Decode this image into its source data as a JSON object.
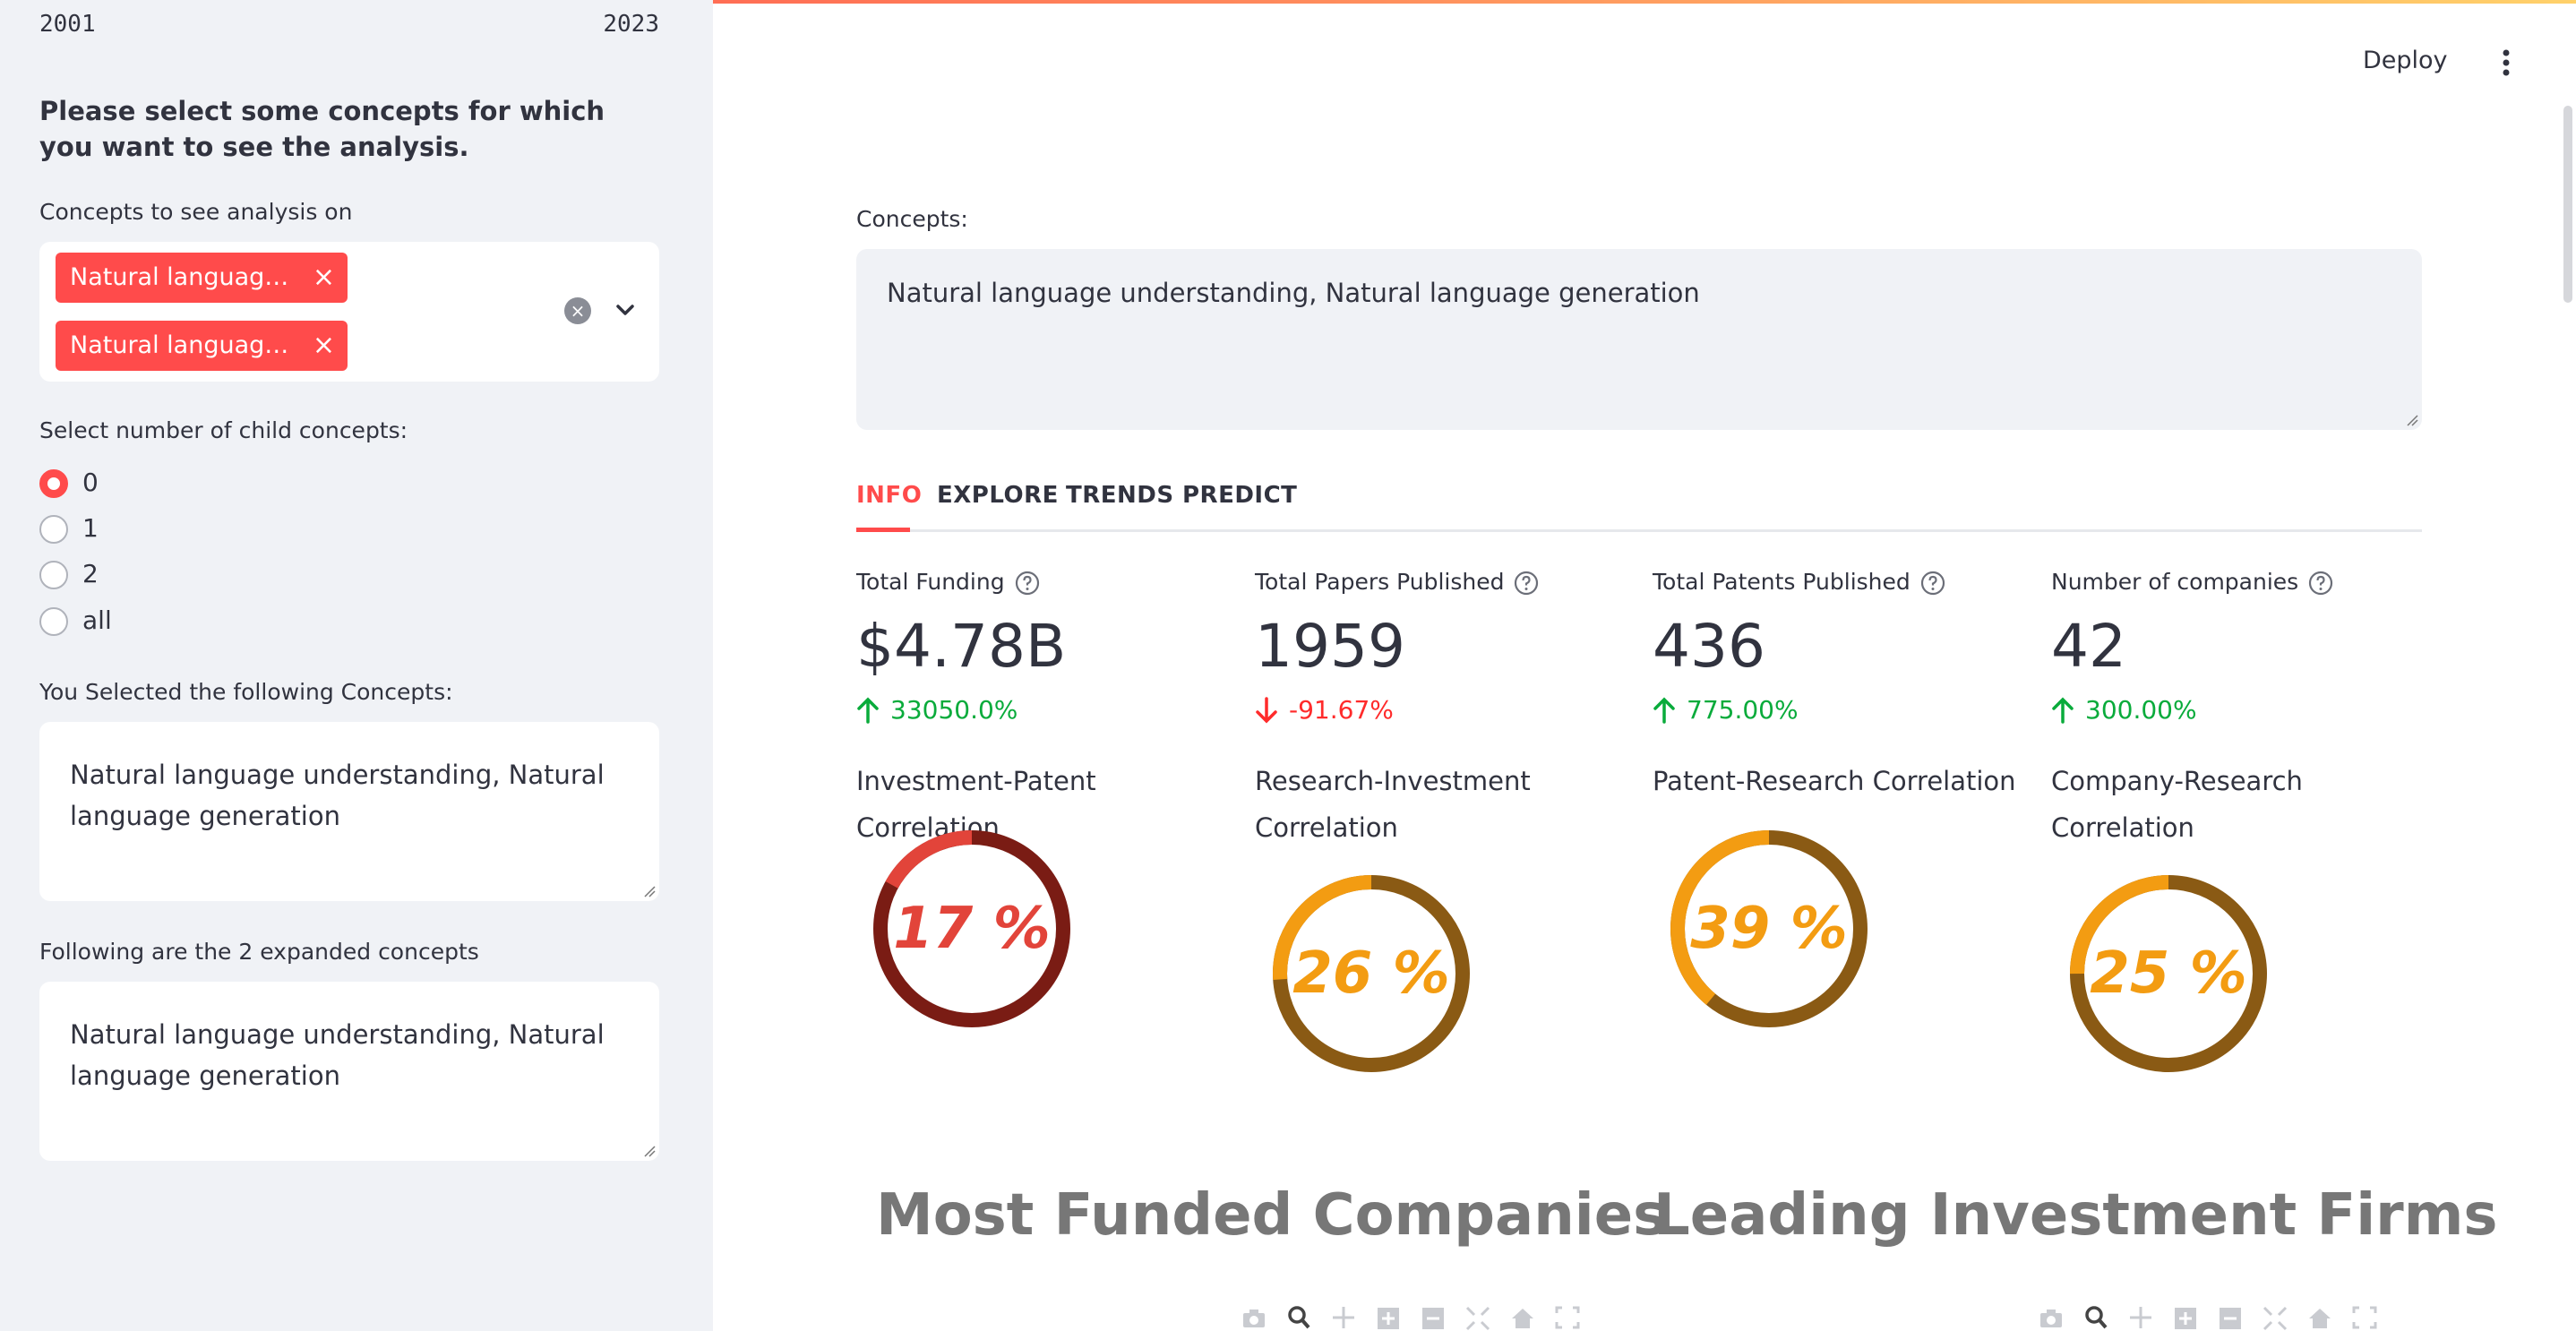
{
  "sidebar": {
    "slider_min": "2001",
    "slider_max": "2023",
    "heading": "Please select some concepts for which you want to see the analysis.",
    "concepts_label": "Concepts to see analysis on",
    "chips": [
      "Natural languag…",
      "Natural languag…"
    ],
    "child_label": "Select number of child concepts:",
    "radio_options": [
      "0",
      "1",
      "2",
      "all"
    ],
    "radio_selected": "0",
    "selected_label": "You Selected the following Concepts:",
    "selected_value": "Natural language understanding, Natural language generation",
    "expanded_label": "Following are the 2 expanded concepts",
    "expanded_value": "Natural language understanding, Natural language generation"
  },
  "header": {
    "deploy": "Deploy"
  },
  "main": {
    "concepts_label": "Concepts:",
    "concepts_value": "Natural language understanding, Natural language generation",
    "tabs": [
      "INFO",
      "EXPLORE",
      "TRENDS",
      "PREDICT"
    ],
    "active_tab": "INFO",
    "metrics": [
      {
        "label": "Total Funding",
        "value": "$4.78B",
        "delta": "33050.0%",
        "direction": "up"
      },
      {
        "label": "Total Papers Published",
        "value": "1959",
        "delta": "-91.67%",
        "direction": "down"
      },
      {
        "label": "Total Patents Published",
        "value": "436",
        "delta": "775.00%",
        "direction": "up"
      },
      {
        "label": "Number of companies",
        "value": "42",
        "delta": "300.00%",
        "direction": "up"
      }
    ],
    "correlations": [
      {
        "title": "Investment-Patent Correlation",
        "percent": 17,
        "text": "17 %",
        "color": "#e2443a",
        "track": "#7a1c14"
      },
      {
        "title": "Research-Investment Correlation",
        "percent": 26,
        "text": "26 %",
        "color": "#f39c12",
        "track": "#8a5a14"
      },
      {
        "title": "Patent-Research Correlation",
        "percent": 39,
        "text": "39 %",
        "color": "#f39c12",
        "track": "#8a5a14"
      },
      {
        "title": "Company-Research Correlation",
        "percent": 25,
        "text": "25 %",
        "color": "#f39c12",
        "track": "#8a5a14"
      }
    ],
    "sections": [
      "Most Funded Companies",
      "Leading Investment Firms"
    ]
  },
  "colors": {
    "accent": "#ff4b4b",
    "up": "#09ab3b",
    "down": "#ff2b2b",
    "sidebar_bg": "#f0f2f6"
  },
  "icons": {
    "chip_remove": "close-icon",
    "clear_all": "clear-icon",
    "dropdown": "chevron-down-icon",
    "help": "help-circle-icon",
    "menu": "kebab-icon",
    "plot_toolbar": [
      "camera-icon",
      "zoom-icon",
      "pan-icon",
      "zoom-in-icon",
      "zoom-out-icon",
      "autoscale-icon",
      "home-icon",
      "fullscreen-icon"
    ]
  }
}
